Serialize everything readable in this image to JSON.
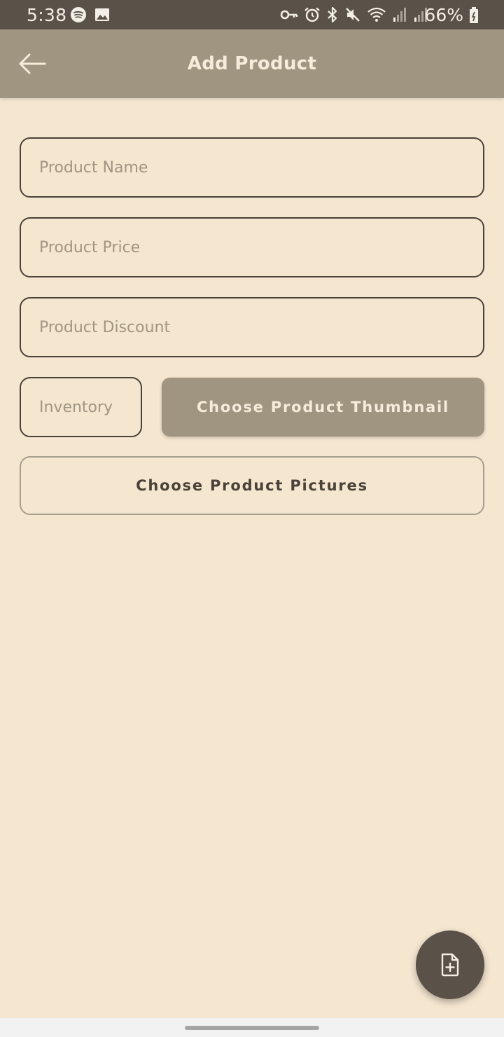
{
  "status_bar": {
    "time": "5:38",
    "battery_percent": "66%",
    "left_icons": [
      "spotify-icon",
      "image-icon"
    ],
    "right_icons": [
      "vpn-key-icon",
      "alarm-icon",
      "bluetooth-icon",
      "mute-icon",
      "wifi-icon",
      "signal-icon",
      "signal-icon",
      "battery-icon"
    ]
  },
  "app_bar": {
    "title": "Add Product",
    "back_icon": "arrow-back-icon"
  },
  "form": {
    "product_name_placeholder": "Product Name",
    "product_price_placeholder": "Product Price",
    "product_discount_placeholder": "Product Discount",
    "inventory_placeholder": "Inventory",
    "thumbnail_button_label": "Choose Product Thumbnail",
    "pictures_button_label": "Choose Product Pictures"
  },
  "fab": {
    "icon": "file-add-icon"
  },
  "colors": {
    "background": "#f5e6d0",
    "status_bar": "#5a5248",
    "app_bar": "#a09580",
    "accent_dark": "#4a4238",
    "fab": "#5a5248"
  }
}
